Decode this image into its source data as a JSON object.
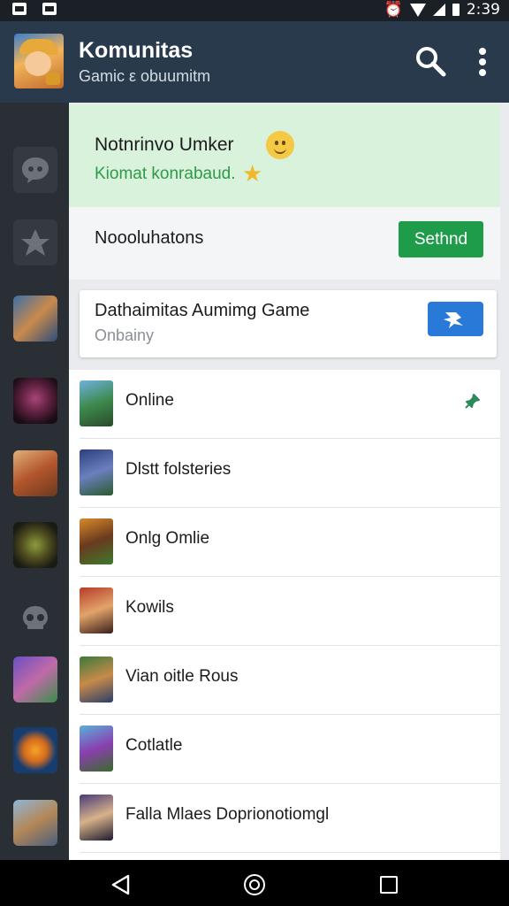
{
  "status_bar": {
    "time": "2:39"
  },
  "app_bar": {
    "title": "Komunitas",
    "subtitle": "Gamic ε obuumitm"
  },
  "welcome_card": {
    "title": "Notnrinvo Umker",
    "subtitle": "Kiomat konrabaud."
  },
  "notifications": {
    "label": "Noooluhatons",
    "button_label": "Sethnd"
  },
  "game_card": {
    "title": "Dathaimitas Aumimg Game",
    "subtitle": "Onbainy"
  },
  "list": [
    {
      "label": "Online",
      "icon": "game-thumbnail"
    },
    {
      "label": "Dlstt folsteries",
      "icon": "game-thumbnail"
    },
    {
      "label": "Onlg Omlie",
      "icon": "game-thumbnail"
    },
    {
      "label": "Kowils",
      "icon": "game-thumbnail"
    },
    {
      "label": "Vian oitle Rous",
      "icon": "game-thumbnail"
    },
    {
      "label": "Cotlatle",
      "icon": "game-thumbnail"
    },
    {
      "label": "Falla Mlaes Doprionotiomgl",
      "icon": "game-thumbnail"
    }
  ],
  "colors": {
    "app_bar": "#283a4c",
    "accent_green": "#1f9c4a",
    "accent_blue": "#2979d8",
    "rail": "#2a2e35"
  }
}
